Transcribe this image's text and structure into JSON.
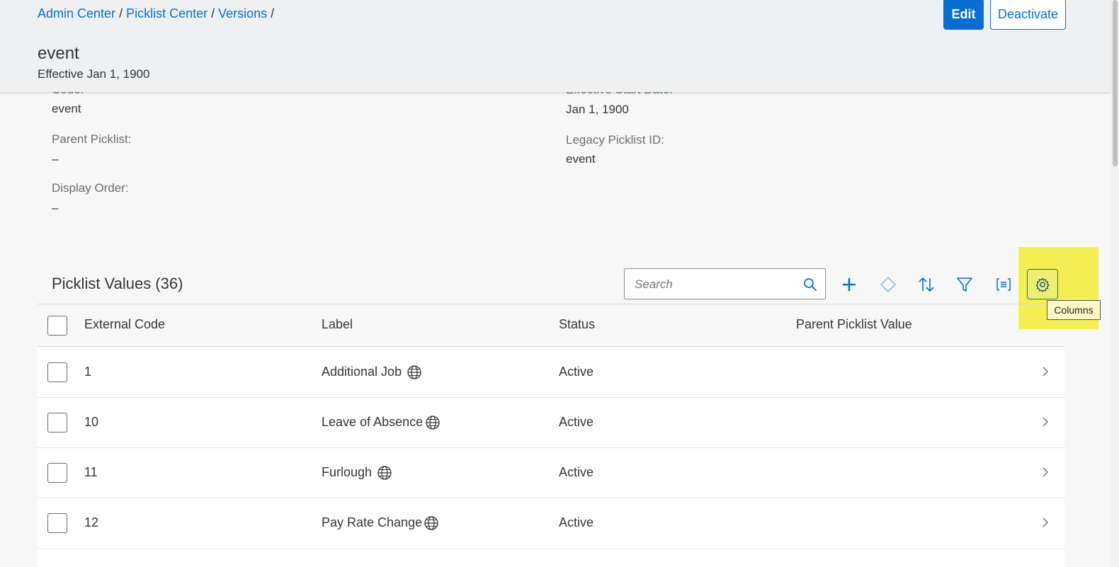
{
  "breadcrumb": {
    "items": [
      "Admin Center",
      "Picklist Center",
      "Versions"
    ],
    "separator": "/"
  },
  "header": {
    "title": "event",
    "subtitle": "Effective Jan 1, 1900",
    "edit_label": "Edit",
    "deactivate_label": "Deactivate"
  },
  "details": {
    "code_label": "Code:",
    "code_value": "event",
    "effective_start_label": "Effective Start Date:",
    "effective_start_value": "Jan 1, 1900",
    "parent_picklist_label": "Parent Picklist:",
    "parent_picklist_value": "–",
    "legacy_id_label": "Legacy Picklist ID:",
    "legacy_id_value": "event",
    "display_order_label": "Display Order:",
    "display_order_value": "–"
  },
  "table": {
    "title": "Picklist Values (36)",
    "search_placeholder": "Search",
    "tooltip": "Columns",
    "columns": [
      "External Code",
      "Label",
      "Status",
      "Parent Picklist Value"
    ],
    "rows": [
      {
        "code": "1",
        "label": "Additional Job",
        "status": "Active",
        "parent": ""
      },
      {
        "code": "10",
        "label": "Leave of Absence",
        "status": "Active",
        "parent": ""
      },
      {
        "code": "11",
        "label": "Furlough",
        "status": "Active",
        "parent": ""
      },
      {
        "code": "12",
        "label": "Pay Rate Change",
        "status": "Active",
        "parent": ""
      }
    ]
  },
  "colors": {
    "accent": "#0a6ed1",
    "highlight": "#f3ef55",
    "header_bg": "#eef0f1"
  }
}
